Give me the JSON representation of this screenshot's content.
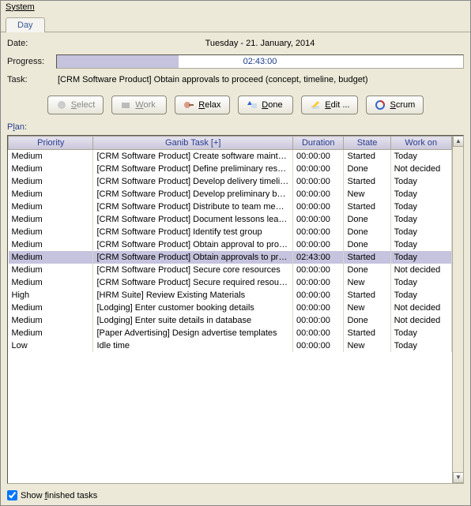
{
  "menu": {
    "system": "System"
  },
  "tab": {
    "day": "Day"
  },
  "labels": {
    "date": "Date:",
    "progress": "Progress:",
    "task": "Task:",
    "plan": "Plan:",
    "show_finished": "Show finished tasks"
  },
  "date_value": "Tuesday - 21. January, 2014",
  "progress": {
    "text": "02:43:00",
    "percent": 30
  },
  "task_value": "[CRM Software Product] Obtain approvals to proceed (concept, timeline, budget)",
  "buttons": {
    "select": "Select",
    "work": "Work",
    "relax": "Relax",
    "done": "Done",
    "edit": "Edit ...",
    "scrum": "Scrum"
  },
  "table": {
    "headers": {
      "priority": "Priority",
      "task": "Ganib Task [+]",
      "duration": "Duration",
      "state": "State",
      "workon": "Work on"
    },
    "rows": [
      {
        "priority": "Medium",
        "task": "[CRM Software Product] Create software maintenanc..",
        "duration": "00:00:00",
        "state": "Started",
        "workon": "Today",
        "sel": false
      },
      {
        "priority": "Medium",
        "task": "[CRM Software Product] Define preliminary resources",
        "duration": "00:00:00",
        "state": "Done",
        "workon": "Not decided",
        "sel": false
      },
      {
        "priority": "Medium",
        "task": "[CRM Software Product] Develop delivery timeline",
        "duration": "00:00:00",
        "state": "Started",
        "workon": "Today",
        "sel": false
      },
      {
        "priority": "Medium",
        "task": "[CRM Software Product] Develop preliminary budget",
        "duration": "00:00:00",
        "state": "New",
        "workon": "Today",
        "sel": false
      },
      {
        "priority": "Medium",
        "task": "[CRM Software Product] Distribute to team members",
        "duration": "00:00:00",
        "state": "Started",
        "workon": "Today",
        "sel": false
      },
      {
        "priority": "Medium",
        "task": "[CRM Software Product] Document lessons learned",
        "duration": "00:00:00",
        "state": "Done",
        "workon": "Today",
        "sel": false
      },
      {
        "priority": "Medium",
        "task": "[CRM Software Product] Identify test group",
        "duration": "00:00:00",
        "state": "Done",
        "workon": "Today",
        "sel": false
      },
      {
        "priority": "Medium",
        "task": "[CRM Software Product] Obtain approval to proceed",
        "duration": "00:00:00",
        "state": "Done",
        "workon": "Today",
        "sel": false
      },
      {
        "priority": "Medium",
        "task": "[CRM Software Product] Obtain approvals to proceed",
        "duration": "02:43:00",
        "state": "Started",
        "workon": "Today",
        "sel": true
      },
      {
        "priority": "Medium",
        "task": "[CRM Software Product] Secure core resources",
        "duration": "00:00:00",
        "state": "Done",
        "workon": "Not decided",
        "sel": false
      },
      {
        "priority": "Medium",
        "task": "[CRM Software Product] Secure required resources",
        "duration": "00:00:00",
        "state": "New",
        "workon": "Today",
        "sel": false
      },
      {
        "priority": "High",
        "task": "[HRM Suite] Review Existing Materials",
        "duration": "00:00:00",
        "state": "Started",
        "workon": "Today",
        "sel": false
      },
      {
        "priority": "Medium",
        "task": "[Lodging] Enter customer booking details",
        "duration": "00:00:00",
        "state": "New",
        "workon": "Not decided",
        "sel": false
      },
      {
        "priority": "Medium",
        "task": "[Lodging] Enter suite details in database",
        "duration": "00:00:00",
        "state": "Done",
        "workon": "Not decided",
        "sel": false
      },
      {
        "priority": "Medium",
        "task": "[Paper Advertising] Design advertise templates",
        "duration": "00:00:00",
        "state": "Started",
        "workon": "Today",
        "sel": false
      },
      {
        "priority": "Low",
        "task": "Idle time",
        "duration": "00:00:00",
        "state": "New",
        "workon": "Today",
        "sel": false
      }
    ]
  },
  "show_finished_checked": true
}
